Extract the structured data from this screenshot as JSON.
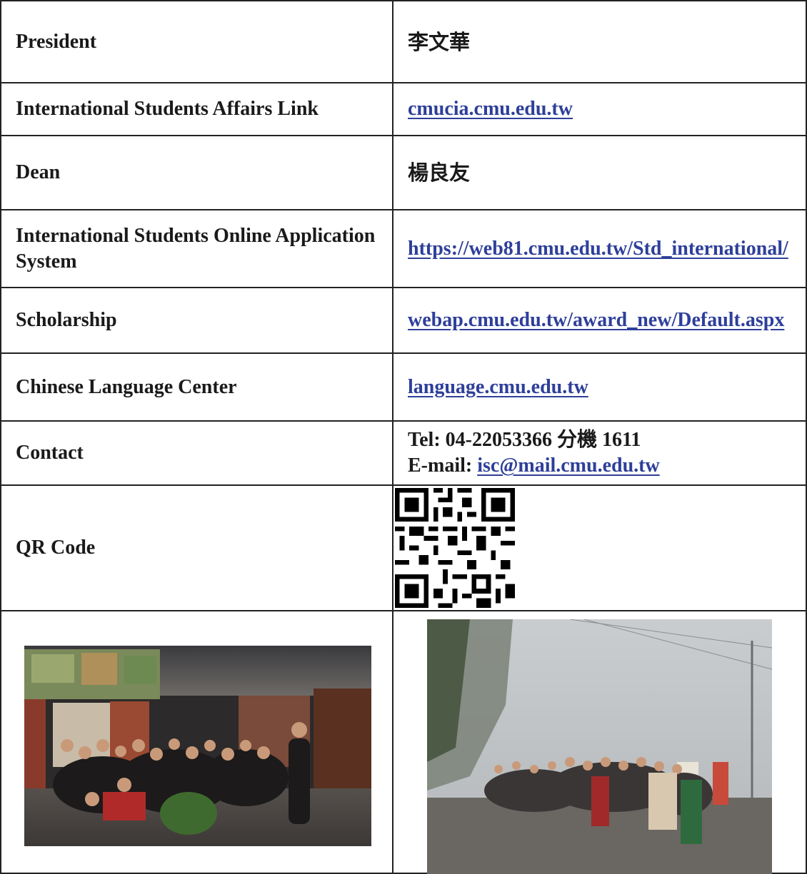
{
  "rows": [
    {
      "label": "President",
      "value": "李文華"
    },
    {
      "label": "International Students Affairs Link",
      "value": "cmucia.cmu.edu.tw"
    },
    {
      "label": "Dean",
      "value": "楊良友"
    },
    {
      "label": "International Students Online Application System",
      "value": "https://web81.cmu.edu.tw/Std_international/"
    },
    {
      "label": "Scholarship",
      "value": "webap.cmu.edu.tw/award_new/Default.aspx"
    },
    {
      "label": "Chinese Language Center",
      "value": "language.cmu.edu.tw"
    },
    {
      "label": "Contact",
      "tel": "Tel: 04-22053366 分機 1611",
      "email_label": "E-mail:",
      "email": "isc@mail.cmu.edu.tw"
    },
    {
      "label": "QR Code"
    }
  ],
  "icons": {
    "qr": "qr-code-image",
    "photo_left": "group-photo-restaurant",
    "photo_right": "group-photo-foggy-mountain"
  },
  "colors": {
    "link": "#2e3f9a",
    "border": "#222222"
  }
}
